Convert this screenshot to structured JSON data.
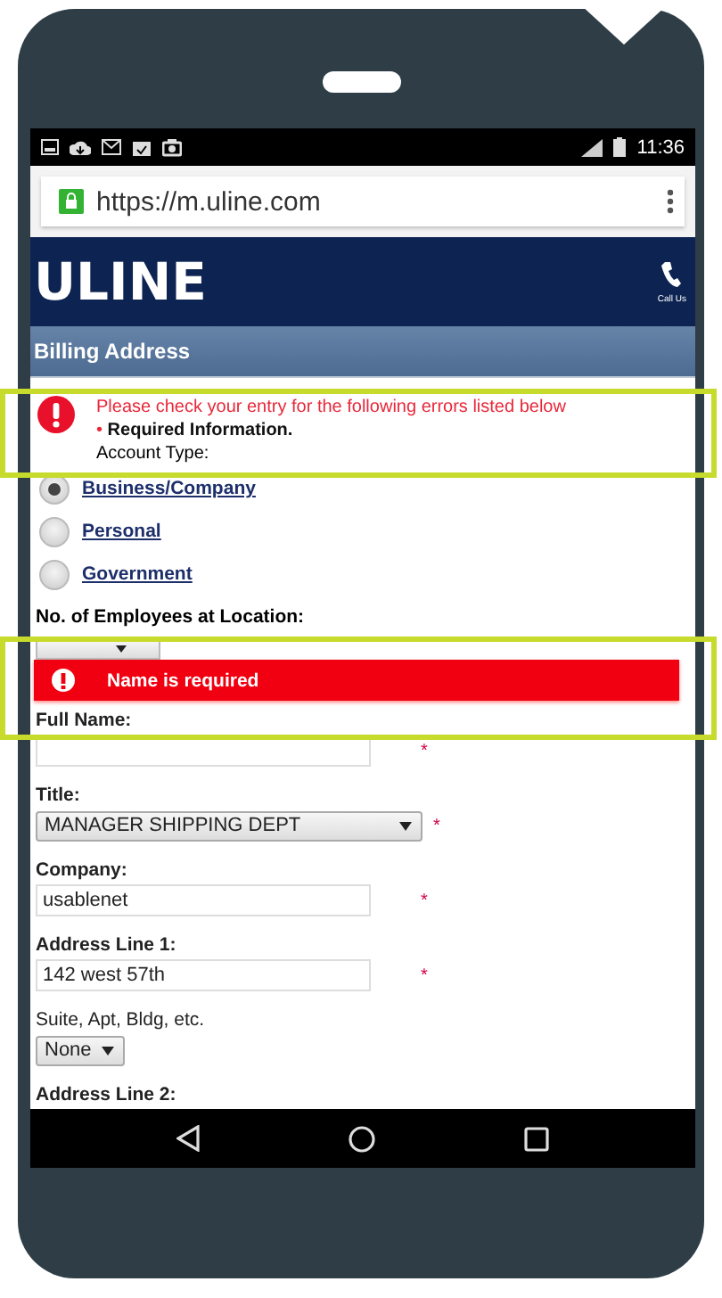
{
  "status_bar": {
    "time": "11:36"
  },
  "browser": {
    "url": "https://m.uline.com"
  },
  "header": {
    "logo": "ULINE",
    "call_label": "Call Us"
  },
  "section_title": "Billing Address",
  "error_summary": {
    "highlighted": true,
    "message": "Please check your entry for the following errors listed below",
    "bullet": "•",
    "item": "Required Information.",
    "field": "Account Type:"
  },
  "account_types": [
    {
      "label": "Business/Company",
      "selected": true
    },
    {
      "label": "Personal",
      "selected": false
    },
    {
      "label": "Government",
      "selected": false
    }
  ],
  "employees": {
    "label": "No. of Employees at Location:"
  },
  "name_error": {
    "highlighted": true,
    "message": "Name is required"
  },
  "fields": [
    {
      "kind": "text",
      "label": "Full Name:",
      "label_bold": true,
      "required_mark": "*"
    },
    {
      "kind": "select",
      "label": "Title:",
      "label_bold": true,
      "value": "MANAGER SHIPPING DEPT",
      "required_mark": "*"
    },
    {
      "kind": "text",
      "label": "Company:",
      "label_bold": true,
      "value": "usablenet",
      "required_mark": "*"
    },
    {
      "kind": "text",
      "label": "Address Line 1:",
      "label_bold": true,
      "value": "142 west 57th",
      "required_mark": "*"
    },
    {
      "kind": "select",
      "label": "Suite, Apt, Bldg, etc.",
      "label_bold": false,
      "value": "None"
    },
    {
      "kind": "label",
      "label": "Address Line 2:",
      "label_bold": true
    }
  ]
}
